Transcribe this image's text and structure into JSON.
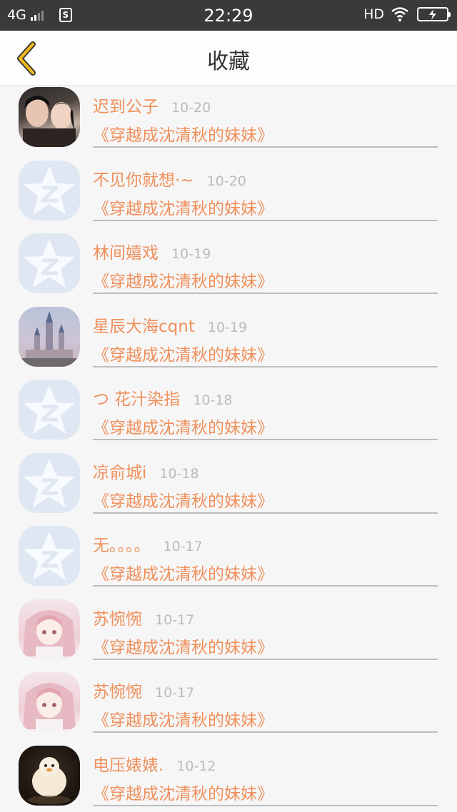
{
  "status_bar": {
    "network": "4G",
    "time": "22:29",
    "hd": "HD",
    "sim_label": "S"
  },
  "header": {
    "title": "收藏",
    "back_icon": "chevron-left-icon",
    "accent": "#f1b91b"
  },
  "list": {
    "items": [
      {
        "name": "迟到公子",
        "date": "10-20",
        "book": "《穿越成沈清秋的妹妹》",
        "avatar": "couple"
      },
      {
        "name": "不见你就想·~",
        "date": "10-20",
        "book": "《穿越成沈清秋的妹妹》",
        "avatar": "qq"
      },
      {
        "name": "林间嬉戏",
        "date": "10-19",
        "book": "《穿越成沈清秋的妹妹》",
        "avatar": "qq"
      },
      {
        "name": "星辰大海cqnt",
        "date": "10-19",
        "book": "《穿越成沈清秋的妹妹》",
        "avatar": "castle"
      },
      {
        "name": "つ 花汁染指",
        "date": "10-18",
        "book": "《穿越成沈清秋的妹妹》",
        "avatar": "qq"
      },
      {
        "name": "凉俞城i",
        "date": "10-18",
        "book": "《穿越成沈清秋的妹妹》",
        "avatar": "qq"
      },
      {
        "name": "无。。。。",
        "date": "10-17",
        "book": "《穿越成沈清秋的妹妹》",
        "avatar": "qq"
      },
      {
        "name": "苏惋惋",
        "date": "10-17",
        "book": "《穿越成沈清秋的妹妹》",
        "avatar": "anime"
      },
      {
        "name": "苏惋惋",
        "date": "10-17",
        "book": "《穿越成沈清秋的妹妹》",
        "avatar": "anime"
      },
      {
        "name": "电压婊婊.",
        "date": "10-12",
        "book": "《穿越成沈清秋的妹妹》",
        "avatar": "toy"
      }
    ]
  },
  "colors": {
    "name_color": "#f0905c",
    "date_color": "#bbbbbb",
    "status_bar_bg": "#3a3a3a"
  }
}
